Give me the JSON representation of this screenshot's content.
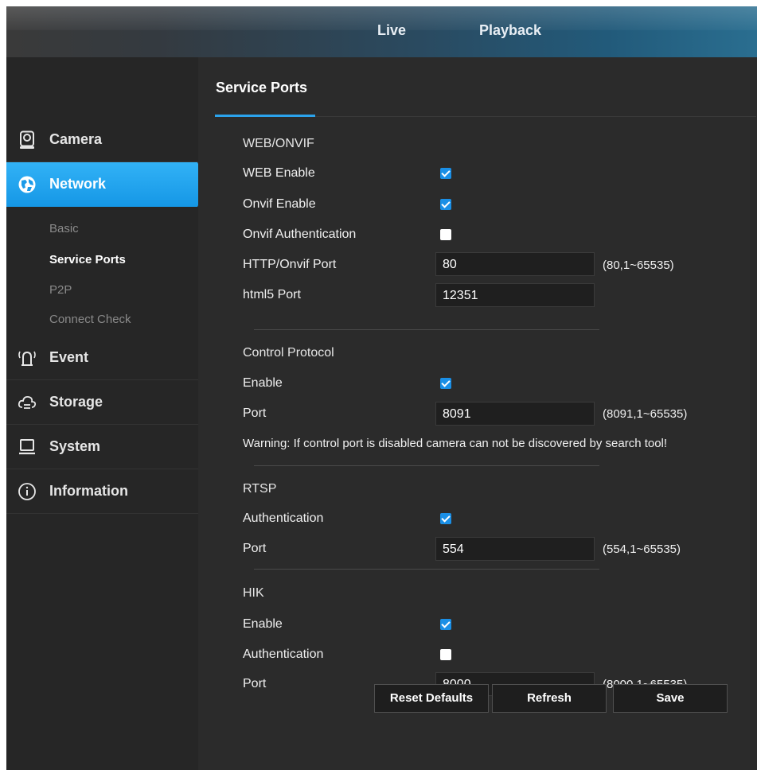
{
  "topnav": {
    "live": "Live",
    "playback": "Playback"
  },
  "sidebar": {
    "items": [
      {
        "label": "Camera",
        "icon": "camera-icon"
      },
      {
        "label": "Network",
        "icon": "network-globe-icon",
        "active": true,
        "children": [
          {
            "label": "Basic"
          },
          {
            "label": "Service Ports",
            "current": true
          },
          {
            "label": "P2P"
          },
          {
            "label": "Connect Check"
          }
        ]
      },
      {
        "label": "Event",
        "icon": "alarm-icon"
      },
      {
        "label": "Storage",
        "icon": "cloud-storage-icon"
      },
      {
        "label": "System",
        "icon": "laptop-icon"
      },
      {
        "label": "Information",
        "icon": "info-icon"
      }
    ]
  },
  "page": {
    "title": "Service Ports"
  },
  "web_onvif": {
    "heading": "WEB/ONVIF",
    "web_enable": {
      "label": "WEB Enable",
      "checked": true
    },
    "onvif_enable": {
      "label": "Onvif Enable",
      "checked": true
    },
    "onvif_auth": {
      "label": "Onvif Authentication",
      "checked": false
    },
    "http_port": {
      "label": "HTTP/Onvif Port",
      "value": "80",
      "hint": "(80,1~65535)"
    },
    "html5_port": {
      "label": "html5 Port",
      "value": "12351"
    }
  },
  "control": {
    "heading": "Control Protocol",
    "enable": {
      "label": "Enable",
      "checked": true
    },
    "port": {
      "label": "Port",
      "value": "8091",
      "hint": "(8091,1~65535)"
    },
    "warning": "Warning: If control port is disabled camera can not be discovered by search tool!"
  },
  "rtsp": {
    "heading": "RTSP",
    "auth": {
      "label": "Authentication",
      "checked": true
    },
    "port": {
      "label": "Port",
      "value": "554",
      "hint": "(554,1~65535)"
    }
  },
  "hik": {
    "heading": "HIK",
    "enable": {
      "label": "Enable",
      "checked": true
    },
    "auth": {
      "label": "Authentication",
      "checked": false
    },
    "port": {
      "label": "Port",
      "value": "8000",
      "hint": "(8000,1~65535)"
    }
  },
  "buttons": {
    "reset": "Reset Defaults",
    "refresh": "Refresh",
    "save": "Save"
  },
  "colors": {
    "accent": "#1a8fe6",
    "active_tab": "#22a4f0",
    "panel": "#2b2b2b",
    "sidebar": "#262626"
  }
}
